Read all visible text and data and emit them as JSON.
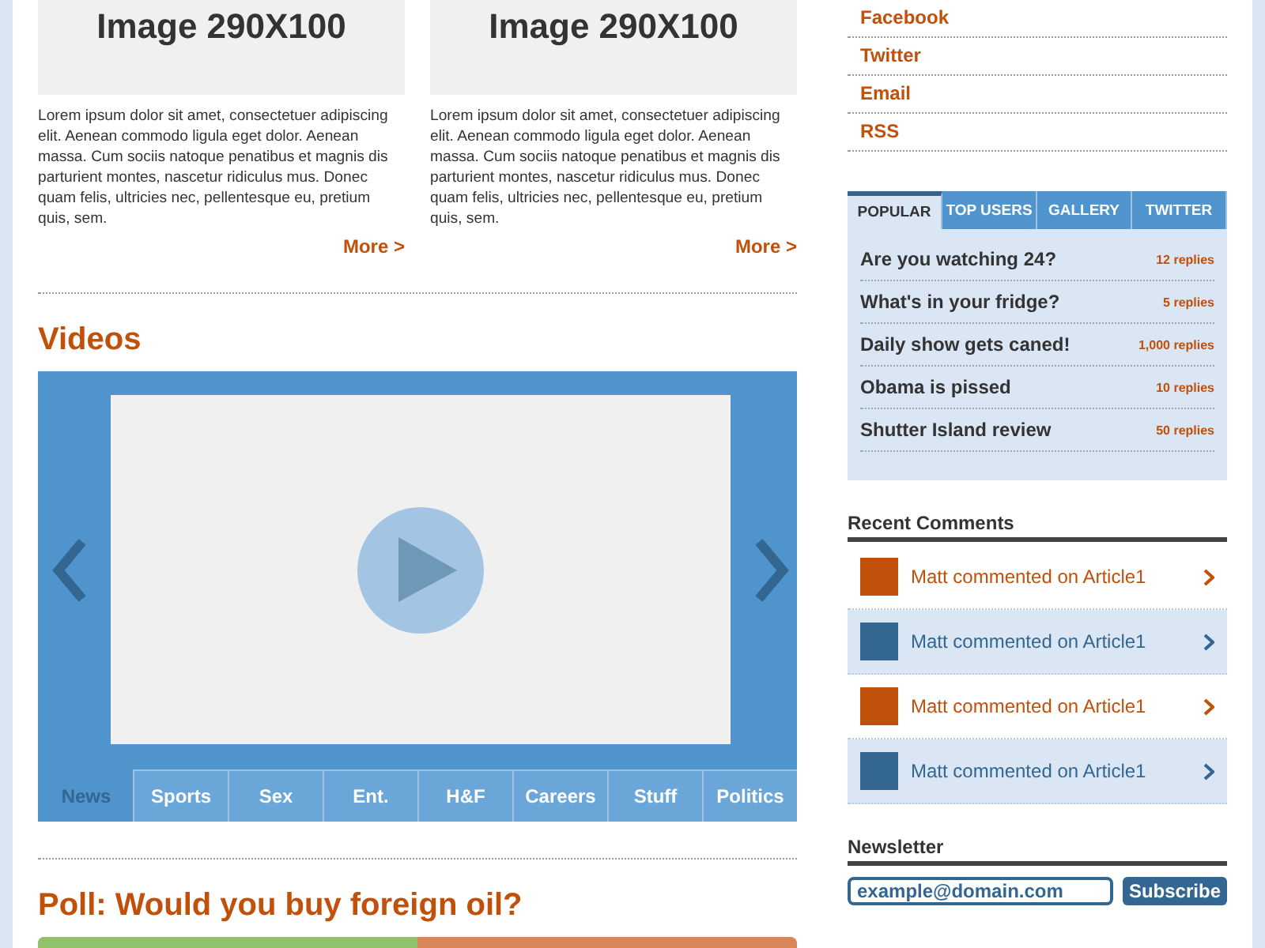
{
  "articles": [
    {
      "image_label": "Image 290X100",
      "text": "Lorem ipsum dolor sit amet, consectetuer adipiscing elit. Aenean commodo ligula eget dolor. Aenean massa. Cum sociis natoque penatibus et magnis dis parturient montes, nascetur ridiculus mus. Donec quam felis, ultricies nec, pellentesque eu, pretium quis, sem.",
      "more": "More >"
    },
    {
      "image_label": "Image 290X100",
      "text": "Lorem ipsum dolor sit amet, consectetuer adipiscing elit. Aenean commodo ligula eget dolor. Aenean massa. Cum sociis natoque penatibus et magnis dis parturient montes, nascetur ridiculus mus. Donec quam felis, ultricies nec, pellentesque eu, pretium quis, sem.",
      "more": "More >"
    }
  ],
  "videos": {
    "title": "Videos",
    "tabs": [
      {
        "label": "News",
        "selected": true
      },
      {
        "label": "Sports",
        "selected": false
      },
      {
        "label": "Sex",
        "selected": false
      },
      {
        "label": "Ent.",
        "selected": false
      },
      {
        "label": "H&F",
        "selected": false
      },
      {
        "label": "Careers",
        "selected": false
      },
      {
        "label": "Stuff",
        "selected": false
      },
      {
        "label": "Politics",
        "selected": false
      }
    ]
  },
  "poll": {
    "title": "Poll: Would you buy foreign oil?",
    "level": 0.5
  },
  "social_links": [
    "Facebook",
    "Twitter",
    "Email",
    "RSS"
  ],
  "topics": {
    "tabs": [
      {
        "label": "POPULAR",
        "selected": true
      },
      {
        "label": "TOP USERS",
        "selected": false
      },
      {
        "label": "GALLERY",
        "selected": false
      },
      {
        "label": "TWITTER",
        "selected": false
      }
    ],
    "items": [
      {
        "title": "Are you watching 24?",
        "replies": "12 replies"
      },
      {
        "title": "What's in your fridge?",
        "replies": "5 replies"
      },
      {
        "title": "Daily show gets caned!",
        "replies": "1,000 replies"
      },
      {
        "title": "Obama is pissed",
        "replies": "10 replies"
      },
      {
        "title": "Shutter Island review",
        "replies": "50 replies"
      }
    ]
  },
  "recent_comments": {
    "title": "Recent Comments",
    "items": [
      {
        "text": "Matt commented on Article1",
        "color": "#c0500a",
        "shaded": false
      },
      {
        "text": "Matt commented on Article1",
        "color": "#336690",
        "shaded": true
      },
      {
        "text": "Matt commented on Article1",
        "color": "#c0500a",
        "shaded": false
      },
      {
        "text": "Matt commented on Article1",
        "color": "#336690",
        "shaded": true
      }
    ]
  },
  "newsletter": {
    "title": "Newsletter",
    "value": "example@domain.com",
    "button": "Subscribe"
  }
}
